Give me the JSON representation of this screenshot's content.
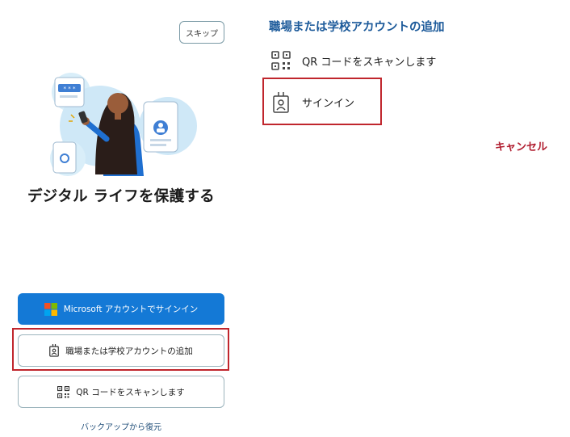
{
  "left_panel": {
    "skip_label": "スキップ",
    "title": "デジタル ライフを保護する",
    "buttons": {
      "microsoft_signin": "Microsoft アカウントでサインイン",
      "add_work_school": "職場または学校アカウントの追加",
      "scan_qr": "QR コードをスキャンします"
    },
    "restore_label": "バックアップから復元"
  },
  "right_panel": {
    "title": "職場または学校アカウントの追加",
    "options": [
      {
        "label": "QR コードをスキャンします",
        "icon": "qr-code-icon"
      },
      {
        "label": "サインイン",
        "icon": "id-badge-icon"
      }
    ],
    "cancel_label": "キャンセル"
  },
  "colors": {
    "primary_button": "#1479d6",
    "right_title": "#1c5a9a",
    "cancel": "#b01c2e",
    "highlight_border": "#c0262d"
  }
}
